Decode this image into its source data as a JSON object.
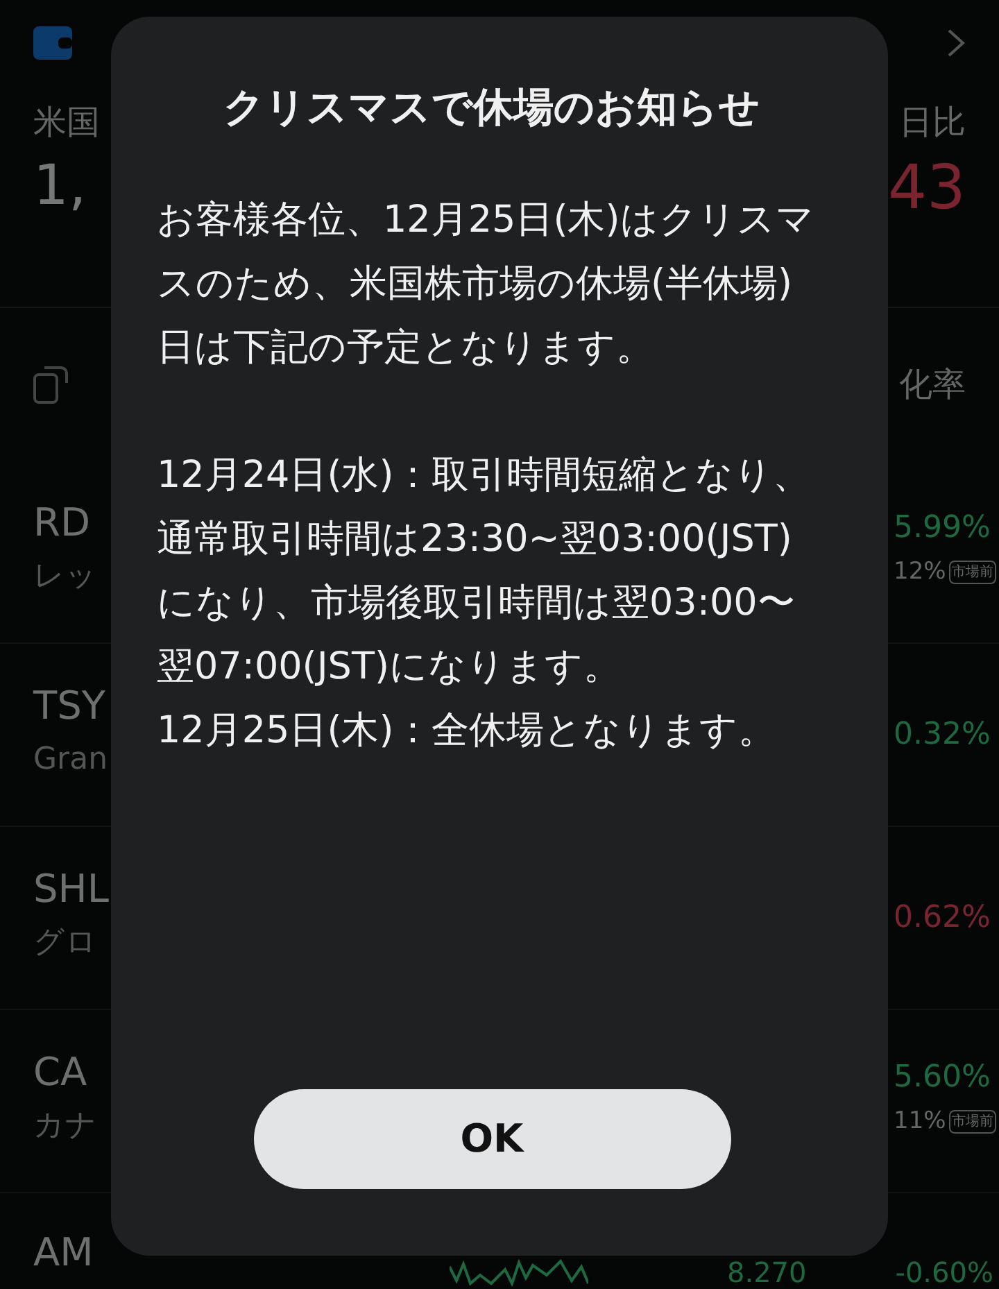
{
  "background": {
    "summary_label": "米国",
    "summary_value": "1,",
    "change_label": "日比",
    "change_value": "43",
    "column_header": "化率",
    "rows": [
      {
        "symbol": "RD",
        "name": "レッ",
        "change": "5.99%",
        "color": "#1d6a40",
        "sub_change": "12%",
        "badge": "市場前"
      },
      {
        "symbol": "TSY",
        "name": "Gran",
        "change": "0.32%",
        "color": "#1d6a40"
      },
      {
        "symbol": "SHL",
        "name": "グロ",
        "change": "0.62%",
        "color": "#7a2430"
      },
      {
        "symbol": "CA",
        "name": "カナ",
        "change": "5.60%",
        "color": "#1d6a40",
        "sub_change": "11%",
        "badge": "市場前"
      },
      {
        "symbol": "AM",
        "price": "8.270",
        "change": "-0.60%",
        "color": "#1d6a40"
      }
    ]
  },
  "dialog": {
    "title": "クリスマスで休場のお知らせ",
    "sections": [
      [
        "お客様各位、12月25日(木)はクリスマスのため、米国株市場の休場(半休場)日は下記の予定となります。"
      ],
      [
        "12月24日(水)：取引時間短縮となり、通常取引時間は23:30~翌03:00(JST)になり、市場後取引時間は翌03:00〜翌07:00(JST)になります。",
        "12月25日(木)：全休場となります。"
      ]
    ],
    "button": "OK"
  }
}
